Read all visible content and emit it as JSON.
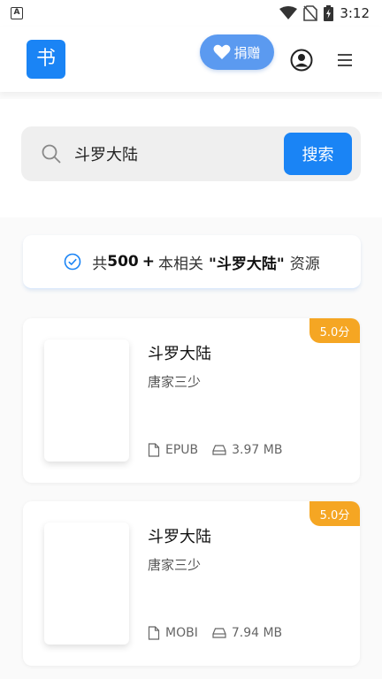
{
  "status_bar": {
    "notification_icon_label": "A",
    "time": "3:12"
  },
  "header": {
    "logo_text": "书",
    "donate_label": "捐赠"
  },
  "search": {
    "query": "斗罗大陆",
    "button_label": "搜索"
  },
  "summary": {
    "prefix": "共",
    "count": "500",
    "plus": "+",
    "middle": "本相关",
    "query_quoted": "\"斗罗大陆\"",
    "suffix": "资源"
  },
  "results": [
    {
      "title": "斗罗大陆",
      "author": "唐家三少",
      "format": "EPUB",
      "size": "3.97 MB",
      "rating": "5.0分"
    },
    {
      "title": "斗罗大陆",
      "author": "唐家三少",
      "format": "MOBI",
      "size": "7.94 MB",
      "rating": "5.0分"
    }
  ],
  "colors": {
    "accent": "#1a84f5",
    "donate": "#5b9af0",
    "rating": "#f5a623"
  },
  "icons": [
    "notification-a-icon",
    "wifi-icon",
    "no-sim-icon",
    "battery-charging-icon",
    "heart-icon",
    "account-icon",
    "menu-icon",
    "search-icon",
    "check-circle-icon",
    "file-icon",
    "drive-icon"
  ]
}
